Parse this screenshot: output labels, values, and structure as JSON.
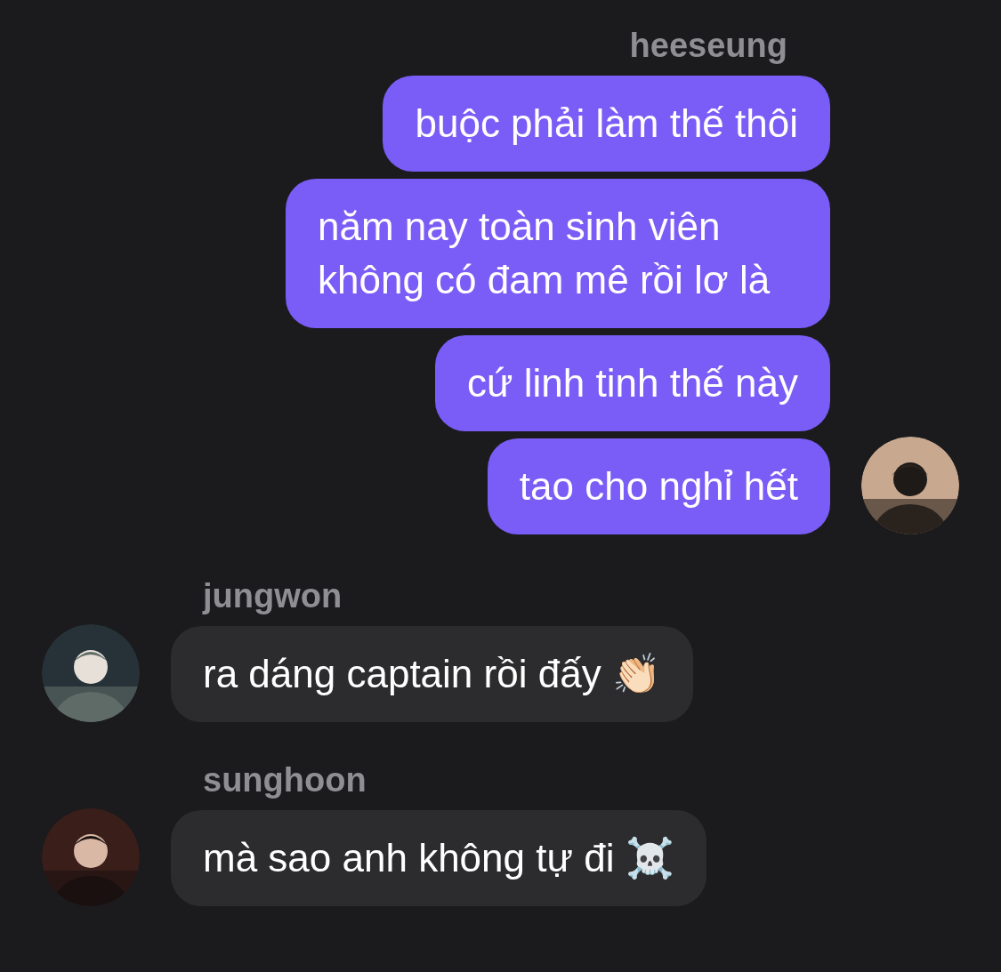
{
  "messages": [
    {
      "kind": "outgoing",
      "sender": "heeseung",
      "bubbles": [
        "buộc phải làm thế thôi",
        "năm nay toàn sinh viên không có đam mê rồi lơ là",
        "cứ linh tinh thế này",
        "tao cho nghỉ hết"
      ]
    },
    {
      "kind": "incoming",
      "sender": "jungwon",
      "bubbles": [
        "ra dáng captain rồi đấy 👏🏻"
      ]
    },
    {
      "kind": "incoming",
      "sender": "sunghoon",
      "bubbles": [
        "mà sao anh không tự đi ☠️"
      ]
    }
  ]
}
